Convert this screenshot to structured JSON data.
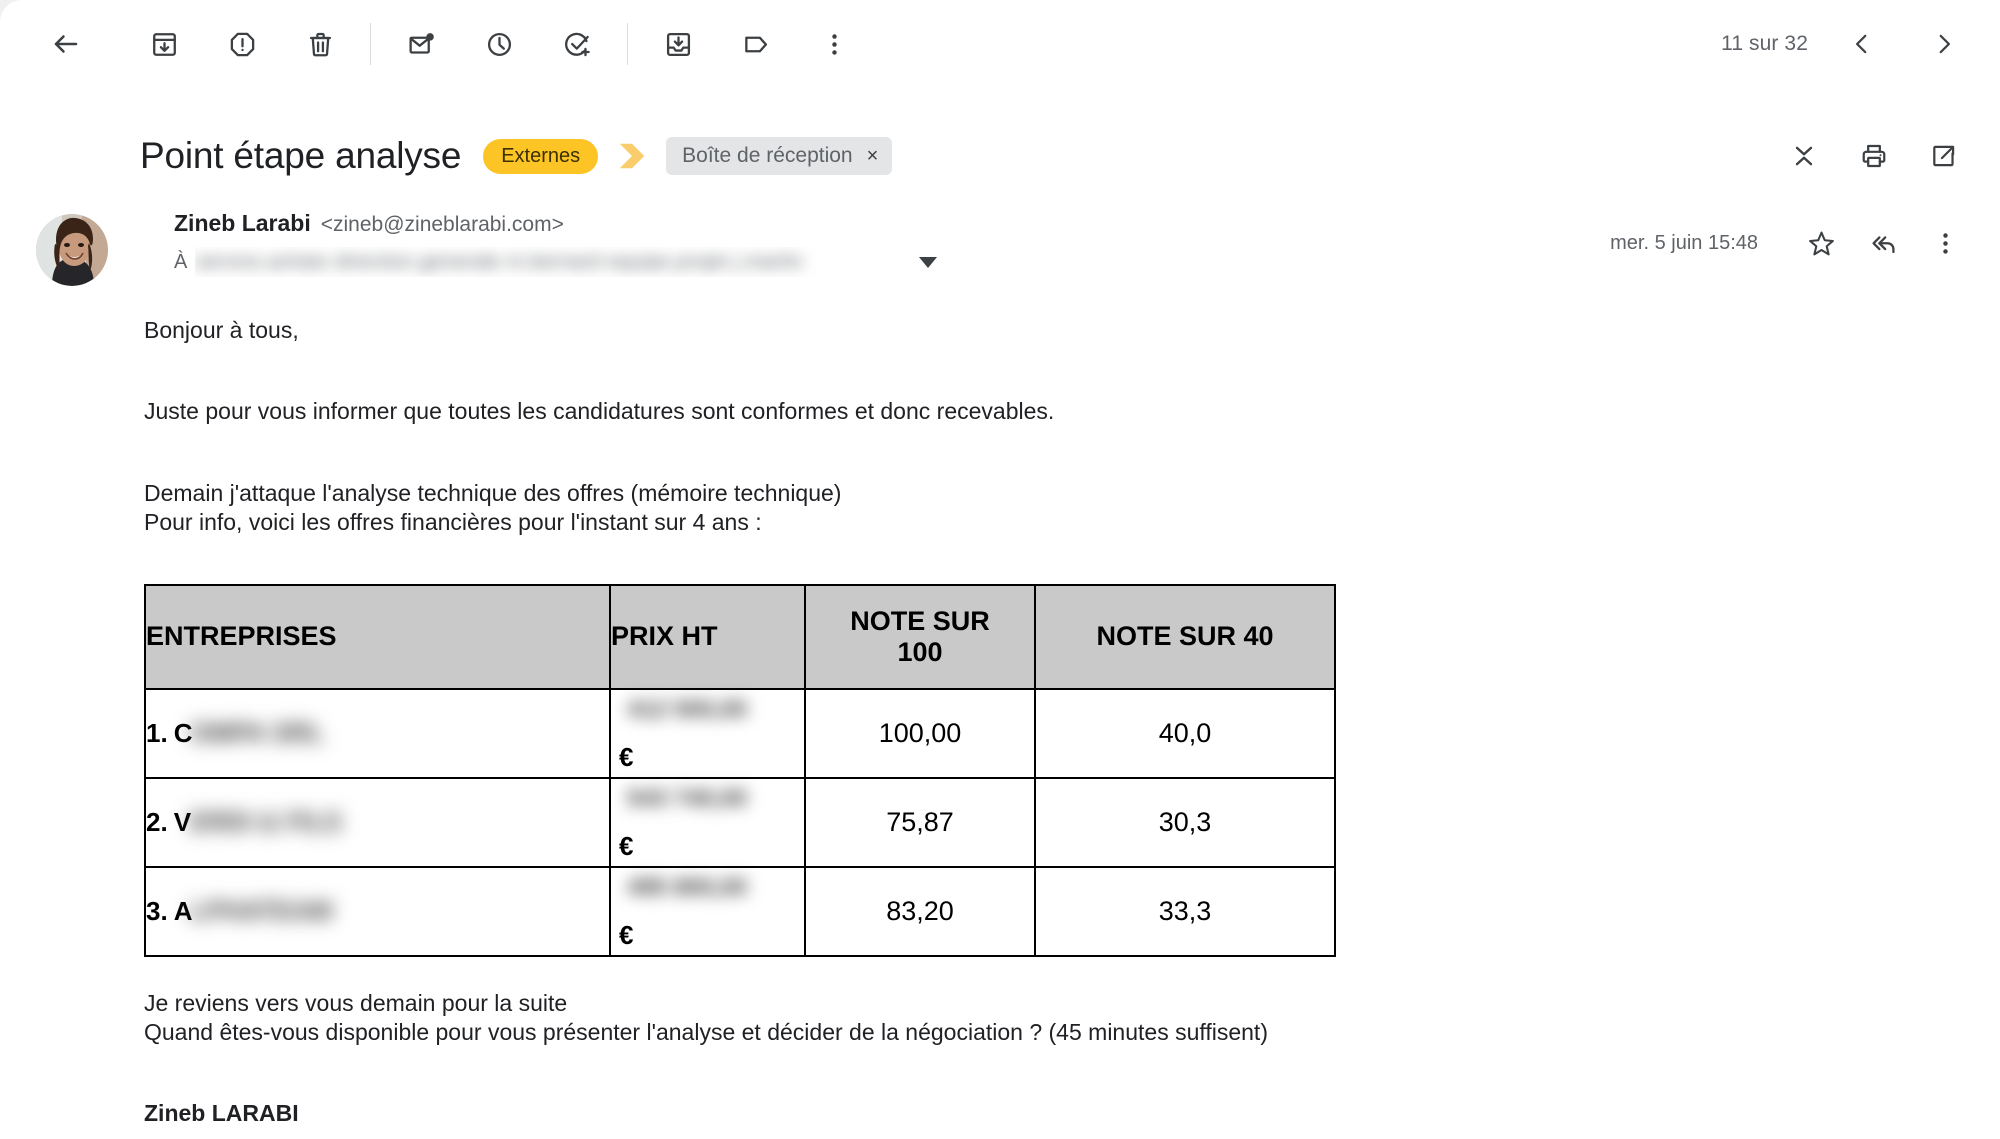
{
  "toolbar": {
    "back_label": "back-arrow",
    "actions": [
      {
        "name": "archive",
        "title": "Archiver"
      },
      {
        "name": "report-spam",
        "title": "Signaler comme spam"
      },
      {
        "name": "delete",
        "title": "Supprimer"
      },
      {
        "name": "mark-unread",
        "title": "Marquer comme non lu"
      },
      {
        "name": "snooze",
        "title": "Mettre en attente"
      },
      {
        "name": "add-task",
        "title": "Ajouter aux tâches"
      },
      {
        "name": "move-to",
        "title": "Déplacer vers"
      },
      {
        "name": "labels",
        "title": "Libellés"
      },
      {
        "name": "more",
        "title": "Plus"
      }
    ],
    "counter": "11 sur 32",
    "prev_title": "Plus ancien",
    "next_title": "Plus récent"
  },
  "subject": {
    "title": "Point étape analyse",
    "label_chip": "Externes",
    "important_marker": "important-marker",
    "inbox_chip": "Boîte de réception",
    "inbox_chip_close": "×",
    "actions": [
      {
        "name": "collapse-all",
        "title": "Tout réduire"
      },
      {
        "name": "print",
        "title": "Imprimer"
      },
      {
        "name": "open-new-window",
        "title": "Ouvrir dans une nouvelle fenêtre"
      }
    ]
  },
  "message": {
    "sender_name": "Zineb Larabi",
    "sender_email": "<zineb@zineblarabi.com>",
    "to_label": "À",
    "to_recipients": "service.achats  direction.generale  m.bernard  equipe.projet  j.martin",
    "date": "mer. 5 juin 15:48",
    "actions": [
      {
        "name": "star",
        "title": "Ajouter un suivi"
      },
      {
        "name": "reply-all",
        "title": "Répondre à tous"
      },
      {
        "name": "more-options",
        "title": "Plus d'options"
      }
    ]
  },
  "body": {
    "greeting": "Bonjour à tous,",
    "p1": "Juste pour vous informer que toutes les candidatures sont conformes et donc recevables.",
    "p2": "Demain j'attaque l'analyse technique des offres (mémoire technique)",
    "p3": "Pour info, voici les offres financières pour l'instant sur 4 ans :",
    "p4": "Je reviens vers vous demain pour la suite",
    "p5": "Quand êtes-vous disponible pour vous présenter l'analyse et décider de la négociation ? (45 minutes suffisent)",
    "signature": "Zineb LARABI"
  },
  "table": {
    "headers": {
      "entreprises": "ENTREPRISES",
      "prix_ht": "PRIX HT",
      "note_100_l1": "NOTE SUR",
      "note_100_l2": "100",
      "note_40": "NOTE SUR 40"
    },
    "rows": [
      {
        "rank": "1.",
        "initial": "C",
        "company_redacted": "OMPA SRL",
        "price_redacted": "412 500,00",
        "currency": "€",
        "note_100": "100,00",
        "note_40": "40,0"
      },
      {
        "rank": "2.",
        "initial": "V",
        "company_redacted": "ERDI & FILS",
        "price_redacted": "543 740,00",
        "currency": "€",
        "note_100": "75,87",
        "note_40": "30,3"
      },
      {
        "rank": "3.",
        "initial": "A",
        "company_redacted": "LPHATEAM",
        "price_redacted": "495 800,00",
        "currency": "€",
        "note_100": "83,20",
        "note_40": "33,3"
      }
    ]
  },
  "colors": {
    "label_chip_bg": "#fcc425",
    "important_marker": "#f9cd6c",
    "inbox_chip_bg": "#e4e5e7",
    "table_header_bg": "#c9c9c9",
    "icon": "#3c4043",
    "muted_text": "#5f6368",
    "text": "#202124"
  }
}
